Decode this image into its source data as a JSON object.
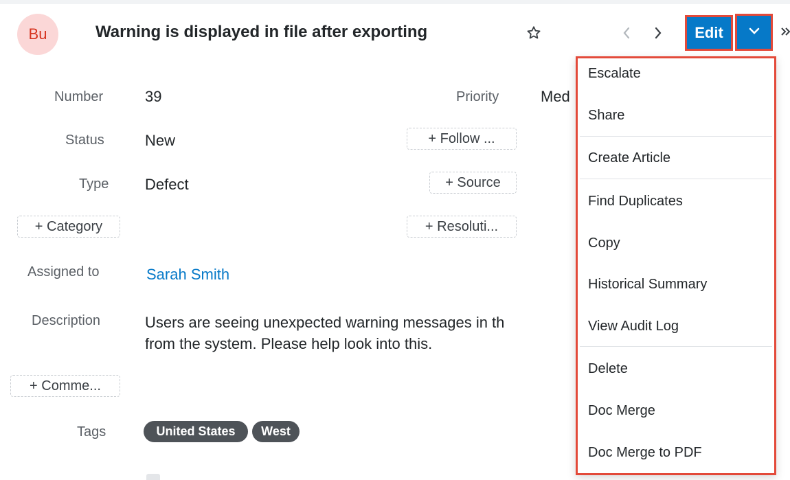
{
  "record": {
    "avatar": "Bu",
    "title": "Warning is displayed in file after exporting",
    "edit_label": "Edit"
  },
  "fields": {
    "number_label": "Number",
    "number_value": "39",
    "priority_label": "Priority",
    "priority_value": "Med",
    "status_label": "Status",
    "status_value": "New",
    "follow_pill": "+ Follow ...",
    "type_label": "Type",
    "type_value": "Defect",
    "source_pill": "+ Source",
    "category_pill": "+ Category",
    "resolution_pill": "+ Resoluti...",
    "assigned_label": "Assigned to",
    "assigned_value": "Sarah Smith",
    "description_label": "Description",
    "description_line1": "Users are seeing unexpected warning messages in th",
    "description_line2": "from the system. Please help look into this.",
    "comment_pill": "+ Comme...",
    "tags_label": "Tags",
    "tags": [
      "United States",
      "West"
    ]
  },
  "menu": {
    "items": [
      "Escalate",
      "Share",
      "Create Article",
      "Find Duplicates",
      "Copy",
      "Historical Summary",
      "View Audit Log",
      "Delete",
      "Doc Merge",
      "Doc Merge to PDF"
    ]
  },
  "icons": {
    "star": "star-outline-icon",
    "prev": "chevron-left-icon",
    "next": "chevron-right-icon",
    "caret": "chevron-down-icon",
    "more": "double-chevron-right-icon"
  },
  "colors": {
    "accent": "#0679c8",
    "highlight": "#e34a3a",
    "avatar_bg": "#fbd7d7",
    "avatar_text": "#d6331f",
    "tag_bg": "#4e5358"
  }
}
